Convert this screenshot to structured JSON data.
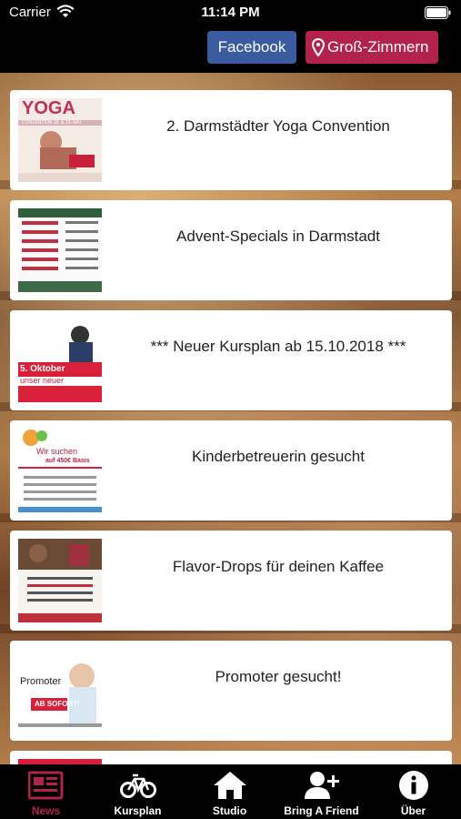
{
  "status_bar": {
    "carrier": "Carrier",
    "time": "11:14 PM"
  },
  "nav": {
    "facebook_label": "Facebook",
    "location_label": "Groß-Zimmern",
    "facebook_color": "#3a5ba0",
    "location_color": "#b3224a"
  },
  "news": [
    {
      "title": "2. Darmstädter Yoga Convention",
      "thumb_text": "YOGA",
      "thumb_sub": "CONVENTION 18. & 19. MAI"
    },
    {
      "title": "Advent-Specials in Darmstadt",
      "thumb_text": "",
      "thumb_sub": ""
    },
    {
      "title": "*** Neuer Kursplan ab 15.10.2018 ***",
      "thumb_text": "5. Oktober",
      "thumb_sub": "unser neuer"
    },
    {
      "title": "Kinderbetreuerin gesucht",
      "thumb_text": "Wir suchen",
      "thumb_sub": "auf 450€ Basis"
    },
    {
      "title": "Flavor-Drops für deinen Kaffee",
      "thumb_text": "",
      "thumb_sub": ""
    },
    {
      "title": "Promoter gesucht!",
      "thumb_text": "Promoter",
      "thumb_sub": "AB SOFORT!"
    }
  ],
  "tabs": [
    {
      "label": "News",
      "icon": "newspaper-icon",
      "active": true
    },
    {
      "label": "Kursplan",
      "icon": "bicycle-icon",
      "active": false
    },
    {
      "label": "Studio",
      "icon": "house-icon",
      "active": false
    },
    {
      "label": "Bring A Friend",
      "icon": "add-user-icon",
      "active": false
    },
    {
      "label": "Über",
      "icon": "info-icon",
      "active": false
    }
  ],
  "colors": {
    "active_tab": "#b3224a",
    "inactive_tab": "#ffffff"
  }
}
